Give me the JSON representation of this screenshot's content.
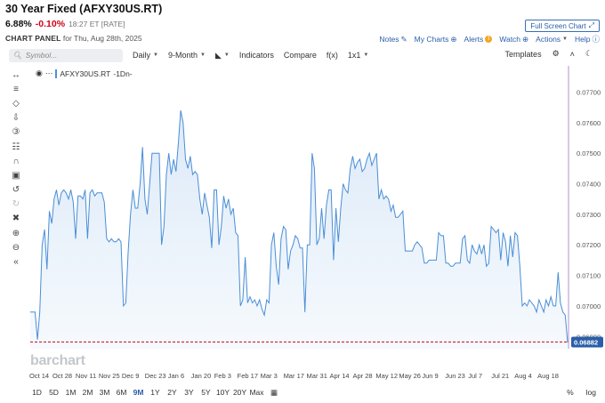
{
  "header": {
    "title": "30 Year Fixed (AFXY30US.RT)",
    "last": "6.88%",
    "change": "-0.10%",
    "time": "18:27 ET [RATE]",
    "fullscreen_label": "Full Screen Chart"
  },
  "panel": {
    "label": "CHART PANEL",
    "date": "for Thu, Aug 28th, 2025",
    "notes": "Notes",
    "my_charts": "My Charts",
    "alerts": "Alerts",
    "watch": "Watch",
    "actions": "Actions",
    "help": "Help"
  },
  "toolbar": {
    "symbol_placeholder": "Symbol...",
    "interval": "Daily",
    "range": "9-Month",
    "indicators": "Indicators",
    "compare": "Compare",
    "fx": "f(x)",
    "layout": "1x1",
    "templates": "Templates"
  },
  "legend": {
    "series": "AFXY30US.RT",
    "suffix": "-1Dn-"
  },
  "watermark": "barchart",
  "periods": [
    "1D",
    "5D",
    "1M",
    "2M",
    "3M",
    "6M",
    "9M",
    "1Y",
    "2Y",
    "3Y",
    "5Y",
    "10Y",
    "20Y",
    "Max"
  ],
  "active_period": "9M",
  "bottom_right": {
    "percent": "%",
    "log": "log"
  },
  "colors": {
    "line": "#4a8ed6",
    "fill": "#dbe9f8",
    "current": "#2a5ea8",
    "ref_line": "#cc2233",
    "axis_line": "#b48fd0"
  },
  "chart_data": {
    "type": "area",
    "series": [
      {
        "name": "AFXY30US.RT"
      }
    ],
    "ylim": [
      0.0686,
      0.0778
    ],
    "yticks": [
      "0.07700",
      "0.07600",
      "0.07500",
      "0.07400",
      "0.07300",
      "0.07200",
      "0.07100",
      "0.07000",
      "0.06900"
    ],
    "ytick_values": [
      0.077,
      0.076,
      0.075,
      0.074,
      0.073,
      0.072,
      0.071,
      0.07,
      0.069
    ],
    "current_value": "0.06882",
    "xticks": [
      "Oct 14",
      "Oct 28",
      "Nov 11",
      "Nov 25",
      "Dec 9",
      "Dec 23",
      "Jan 6",
      "Jan 20",
      "Feb 3",
      "Feb 17",
      "Mar 3",
      "Mar 17",
      "Mar 31",
      "Apr 14",
      "Apr 28",
      "May 12",
      "May 26",
      "Jun 9",
      "Jun 23",
      "Jul 7",
      "Jul 21",
      "Aug 4",
      "Aug 18"
    ],
    "values": [
      0.0698,
      0.0698,
      0.0698,
      0.0689,
      0.0698,
      0.072,
      0.0725,
      0.0712,
      0.0731,
      0.0727,
      0.0735,
      0.0738,
      0.0733,
      0.0737,
      0.0738,
      0.0737,
      0.0735,
      0.0738,
      0.0734,
      0.0722,
      0.0736,
      0.0736,
      0.0735,
      0.0738,
      0.0722,
      0.0737,
      0.0738,
      0.0736,
      0.0737,
      0.0737,
      0.0737,
      0.0734,
      0.0722,
      0.0721,
      0.0722,
      0.0721,
      0.0721,
      0.0722,
      0.0721,
      0.07,
      0.0701,
      0.0718,
      0.073,
      0.0738,
      0.0732,
      0.0732,
      0.074,
      0.0752,
      0.0735,
      0.073,
      0.074,
      0.075,
      0.075,
      0.075,
      0.075,
      0.072,
      0.0726,
      0.0743,
      0.075,
      0.0743,
      0.0748,
      0.0744,
      0.0753,
      0.0764,
      0.076,
      0.0748,
      0.0745,
      0.0749,
      0.0743,
      0.0744,
      0.0743,
      0.0735,
      0.073,
      0.0737,
      0.0733,
      0.0729,
      0.0719,
      0.0738,
      0.0738,
      0.072,
      0.0726,
      0.0736,
      0.0732,
      0.0735,
      0.073,
      0.0732,
      0.0724,
      0.0723,
      0.07,
      0.0702,
      0.0716,
      0.0701,
      0.0703,
      0.0701,
      0.0702,
      0.07,
      0.0702,
      0.0699,
      0.0697,
      0.0702,
      0.0701,
      0.072,
      0.0724,
      0.0713,
      0.0707,
      0.0722,
      0.0726,
      0.0725,
      0.0712,
      0.0718,
      0.072,
      0.0723,
      0.0722,
      0.0719,
      0.0719,
      0.0698,
      0.072,
      0.072,
      0.075,
      0.0745,
      0.072,
      0.0722,
      0.0732,
      0.0722,
      0.0733,
      0.0738,
      0.0738,
      0.0715,
      0.0732,
      0.0721,
      0.0732,
      0.074,
      0.0738,
      0.0737,
      0.0745,
      0.0749,
      0.0745,
      0.0747,
      0.0748,
      0.0744,
      0.0745,
      0.0748,
      0.075,
      0.0746,
      0.0748,
      0.075,
      0.0735,
      0.0738,
      0.0735,
      0.0736,
      0.0735,
      0.0731,
      0.0733,
      0.0729,
      0.0729,
      0.073,
      0.0731,
      0.0718,
      0.0718,
      0.0718,
      0.0718,
      0.072,
      0.0721,
      0.072,
      0.0719,
      0.0714,
      0.0714,
      0.0715,
      0.0715,
      0.0715,
      0.0715,
      0.0724,
      0.0723,
      0.0723,
      0.0714,
      0.0714,
      0.0713,
      0.0713,
      0.0714,
      0.0714,
      0.0714,
      0.0722,
      0.0723,
      0.0715,
      0.0714,
      0.072,
      0.0718,
      0.0717,
      0.072,
      0.0717,
      0.072,
      0.0713,
      0.0714,
      0.0726,
      0.0725,
      0.0724,
      0.0725,
      0.0715,
      0.0724,
      0.0721,
      0.0713,
      0.0723,
      0.0716,
      0.0724,
      0.0723,
      0.0713,
      0.07,
      0.0701,
      0.07,
      0.0702,
      0.0701,
      0.07,
      0.0698,
      0.0702,
      0.07,
      0.0698,
      0.0702,
      0.07,
      0.0703,
      0.07,
      0.07,
      0.0711,
      0.0701,
      0.0698,
      0.0697,
      0.0688
    ]
  }
}
